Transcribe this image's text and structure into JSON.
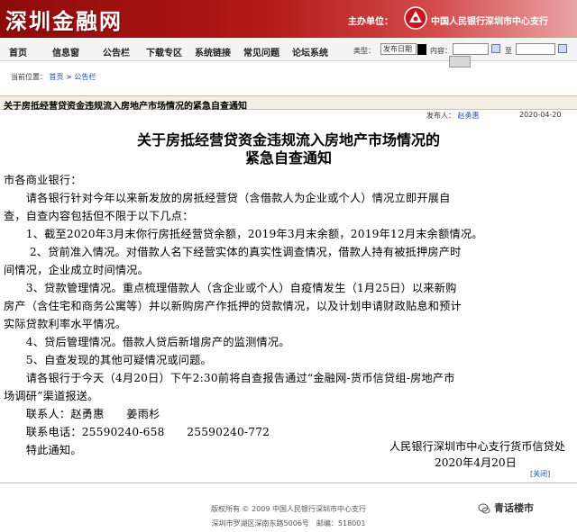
{
  "header": {
    "site_logo": "深圳金融网",
    "sponsor_label": "主办单位：",
    "bank_name": "中国人民银行深圳市中心支行"
  },
  "nav": {
    "items": [
      "首页",
      "信息窗",
      "公告栏",
      "下载专区",
      "系统链接",
      "常见问题",
      "论坛系统"
    ],
    "type_label": "类型：",
    "type_value": "发布日期",
    "content_label": "内容：",
    "to_label": "至"
  },
  "breadcrumb": {
    "prefix": "当前位置：",
    "home": "首页",
    "section": "公告栏"
  },
  "article": {
    "bar_title": "关于房抵经营贷资金违规流入房地产市场情况的紧急自查通知",
    "author_label": "发布人：",
    "author": "赵勇惠",
    "date": "2020-04-20",
    "heading_line1": "关于房抵经营贷资金违规流入房地产市场情况的",
    "heading_line2": "紧急自查通知",
    "lines": [
      "市各商业银行：",
      "　　请各银行针对今年以来新发放的房抵经营贷（含借款人为企业或个人）情况立即开展自",
      "查，自查内容包括但不限于以下几点：",
      "　　1、截至2020年3月末你行房抵经营贷余额，2019年3月末余额，2019年12月末余额情况。",
      "　　 2、贷前准入情况。对借款人名下经营实体的真实性调查情况，借款人持有被抵押房产时",
      "间情况，企业成立时间情况。",
      "　　3、贷款管理情况。重点梳理借款人（含企业或个人）自疫情发生（1月25日）以来新购",
      "房产（含住宅和商务公寓等）并以新购房产作抵押的贷款情况，以及计划申请财政贴息和预计",
      "实际贷款利率水平情况。",
      "　　4、贷后管理情况。借款人贷后新增房产的监测情况。",
      "　　5、自查发现的其他可疑情况或问题。",
      "　　请各银行于今天（4月20日）下午2:30前将自查报告通过“金融网-货币信贷组-房地产市",
      "场调研”渠道报送。",
      "　　联系人：赵勇惠　　姜雨杉",
      "　　联系电话：25590240-658　　25590240-772",
      "　　特此通知。"
    ],
    "signature": "人民银行深圳市中心支行货币信贷处",
    "sign_date": "2020年4月20日",
    "close_label": "关闭"
  },
  "footer": {
    "copyright": "版权所有 © 2009 中国人民银行深圳市中心支行",
    "address": "深圳市罗湖区深南东路5006号　邮编：518001",
    "watermark": "青话楼市"
  },
  "colors": {
    "banner_red": "#b31717",
    "link_blue": "#1f4fa8"
  }
}
